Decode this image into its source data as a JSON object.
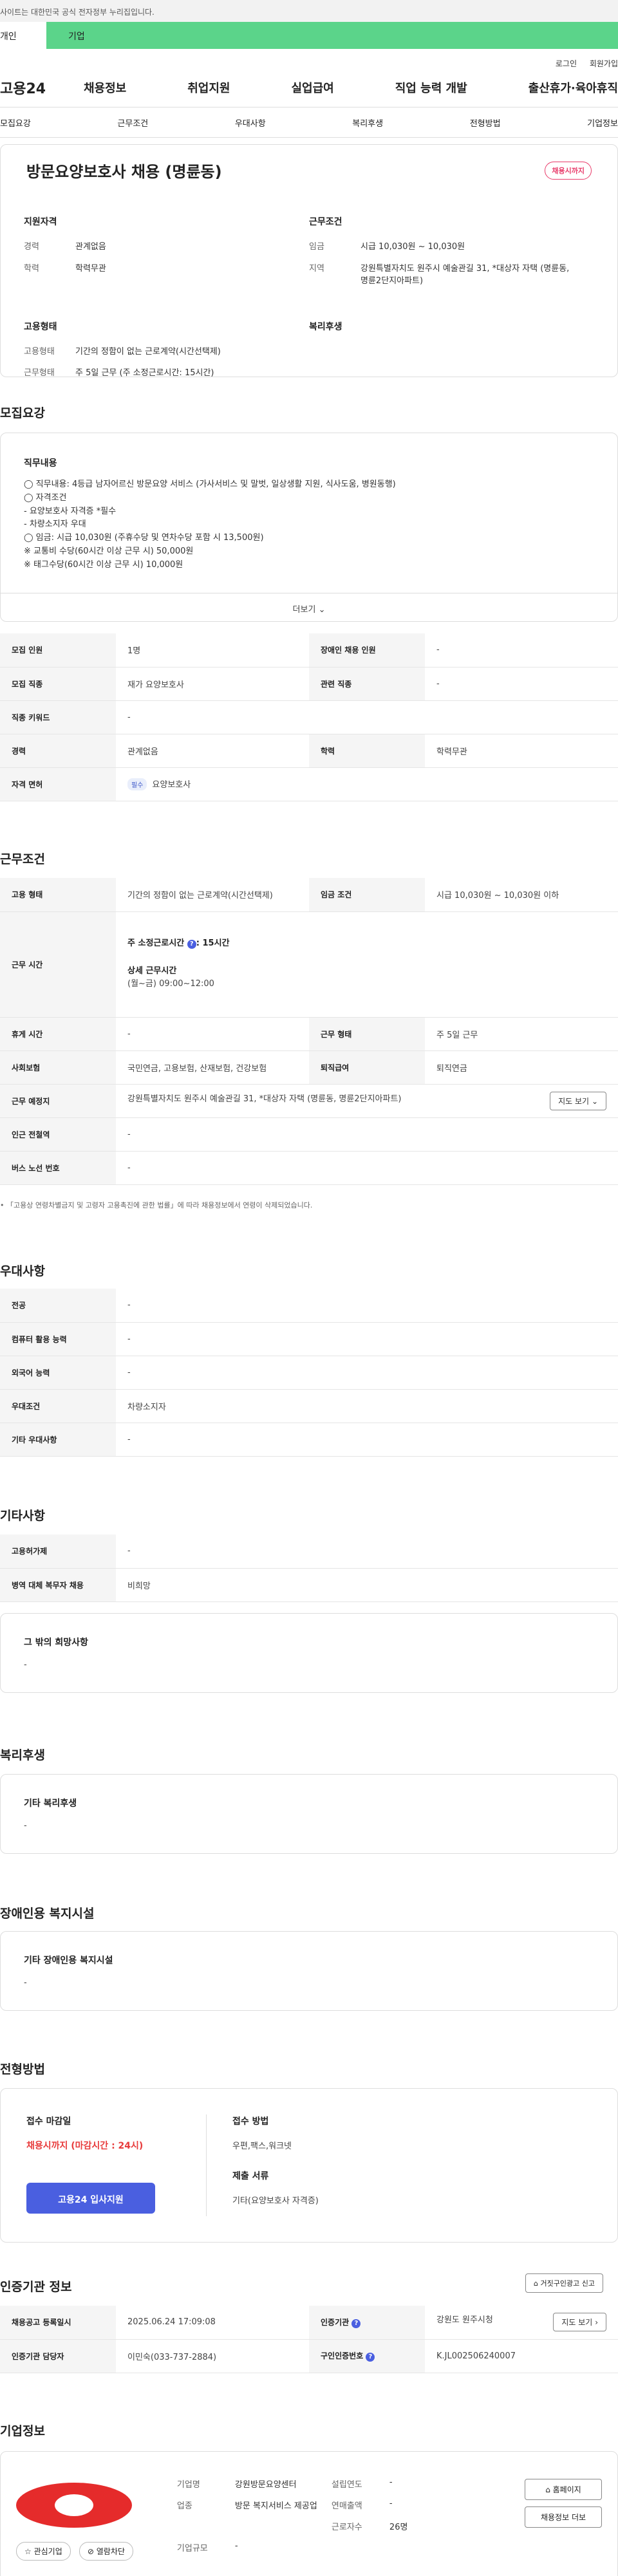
{
  "topbar": {
    "notice": "사이트는 대한민국 공식 전자정부 누리집입니다."
  },
  "pilltabs": {
    "individual": "개인",
    "company": "기업"
  },
  "util": {
    "login": "로그인",
    "join": "회원가입"
  },
  "gnb": {
    "logo": "고용24",
    "menu": [
      "채용정보",
      "취업지원",
      "실업급여",
      "직업 능력 개발",
      "출산휴가·육아휴직"
    ]
  },
  "anchors": [
    "모집요강",
    "근무조건",
    "우대사항",
    "복리후생",
    "전형방법",
    "기업정보"
  ],
  "header": {
    "title": "방문요양보호사 채용 (명륜동)",
    "badge": "채용시까지",
    "qual_title": "지원자격",
    "qual": [
      {
        "k": "경력",
        "v": "관계없음"
      },
      {
        "k": "학력",
        "v": "학력무관"
      }
    ],
    "cond_title": "근무조건",
    "cond": [
      {
        "k": "임금",
        "v": "시급 10,030원 ~ 10,030원"
      },
      {
        "k": "지역",
        "v": "강원특별자치도 원주시 예술관길 31, *대상자 자택 (명륜동, 명륜2단지아파트)"
      }
    ],
    "emp_title": "고용형태",
    "emp": [
      {
        "k": "고용형태",
        "v": "기간의 정함이 없는 근로계약(시간선택제)"
      },
      {
        "k": "근무형태",
        "v": "주 5일 근무 (주 소정근로시간: 15시간)"
      }
    ],
    "welfare_title": "복리후생"
  },
  "recruit": {
    "title": "모집요강",
    "desc_title": "직무내용",
    "desc_lines": [
      "◯ 직무내용: 4등급 남자어르신 방문요양 서비스 (가사서비스 및 말벗, 일상생활 지원, 식사도움, 병원동행)",
      "",
      "◯ 자격조건",
      "- 요양보호사 자격증 *필수",
      "- 차량소지자 우대",
      "",
      "◯ 임금: 시급 10,030원 (주휴수당 및 연차수당 포함 시 13,500원)",
      "※ 교통비 수당(60시간 이상 근무 시) 50,000원",
      "※ 태그수당(60시간 이상 근무 시) 10,000원"
    ],
    "more": "더보기",
    "rows": [
      {
        "k1": "모집 인원",
        "v1": "1명",
        "k2": "장애인 채용 인원",
        "v2": "-"
      },
      {
        "k1": "모집 직종",
        "v1": "재가 요양보호사",
        "k2": "관련 직종",
        "v2": "-"
      },
      {
        "k1": "직종 키워드",
        "v1": "-"
      },
      {
        "k1": "경력",
        "v1": "관계없음",
        "k2": "학력",
        "v2": "학력무관"
      }
    ],
    "license_k": "자격 면허",
    "license_tag": "필수",
    "license_v": "요양보호사"
  },
  "work": {
    "title": "근무조건",
    "emp_k": "고용 형태",
    "emp_v": "기간의 정함이 없는 근로계약(시간선택제)",
    "wage_k": "임금 조건",
    "wage_v": "시급 10,030원 ~ 10,030원 이하",
    "time_k": "근무 시간",
    "time_main": "주 소정근로시간",
    "time_hours": ": 15시간",
    "time_detail_title": "상세 근무시간",
    "time_detail": "(월~금) 09:00~12:00",
    "rest_k": "휴게 시간",
    "rest_v": "-",
    "type_k": "근무 형태",
    "type_v": "주 5일 근무",
    "ins_k": "사회보험",
    "ins_v": "국민연금, 고용보험, 산재보험, 건강보험",
    "ret_k": "퇴직급여",
    "ret_v": "퇴직연금",
    "place_k": "근무 예정지",
    "place_v": "강원특별자치도 원주시 예술관길 31, *대상자 자택 (명륜동, 명륜2단지아파트)",
    "map_btn": "지도 보기",
    "subway_k": "인근 전철역",
    "subway_v": "-",
    "bus_k": "버스 노선 번호",
    "bus_v": "-",
    "note": "「고용상 연령차별금지 및 고령자 고용촉진에 관한 법률」에 따라 채용정보에서 연령이 삭제되었습니다."
  },
  "pref": {
    "title": "우대사항",
    "rows": [
      {
        "k": "전공",
        "v": "-"
      },
      {
        "k": "컴퓨터 활용 능력",
        "v": "-"
      },
      {
        "k": "외국어 능력",
        "v": "-"
      },
      {
        "k": "우대조건",
        "v": "차량소지자"
      },
      {
        "k": "기타 우대사항",
        "v": "-"
      }
    ]
  },
  "etc": {
    "title": "기타사항",
    "rows": [
      {
        "k": "고용허가제",
        "v": "-"
      },
      {
        "k": "병역 대체 복무자 채용",
        "v": "비희망"
      }
    ],
    "box_title": "그 밖의 희망사항",
    "box_v": "-"
  },
  "welfare": {
    "title": "복리후생",
    "box_title": "기타 복리후생",
    "box_v": "-"
  },
  "disabled": {
    "title": "장애인용 복지시설",
    "box_title": "기타 장애인용 복지시설",
    "box_v": "-"
  },
  "apply": {
    "title": "전형방법",
    "deadline_title": "접수 마감일",
    "deadline_v": "채용시까지 (마감시간 : 24시)",
    "apply_btn": "고용24 입사지원",
    "method_title": "접수 방법",
    "method_v": "우편,팩스,워크넷",
    "doc_title": "제출 서류",
    "doc_v": "기타(요양보호사 자격증)"
  },
  "auth": {
    "title": "인증기관 정보",
    "report_btn": "거짓구인광고 신고",
    "reg_k": "채용공고 등록일시",
    "reg_v": "2025.06.24 17:09:08",
    "org_k": "인증기관",
    "org_v": "강원도 원주시청",
    "map_btn": "지도 보기",
    "mgr_k": "인증기관 담당자",
    "mgr_v": "이민숙(033-737-2884)",
    "no_k": "구인인증번호",
    "no_v": "K.JL002506240007"
  },
  "company": {
    "title": "기업정보",
    "fav_btn": "관심기업",
    "block_btn": "열람차단",
    "rows": [
      {
        "k1": "기업명",
        "v1": "강원방문요양센터",
        "k2": "설립연도",
        "v2": "-"
      },
      {
        "k1": "업종",
        "v1": "방문 복지서비스 제공업",
        "k2": "연매출액",
        "v2": "-"
      },
      {
        "k1": "",
        "v1": "",
        "k2": "근로자수",
        "v2": "26명"
      },
      {
        "k1": "기업규모",
        "v1": "-",
        "k2": "",
        "v2": ""
      }
    ],
    "home_btn": "홈페이지",
    "more_btn": "채용정보 더보"
  }
}
